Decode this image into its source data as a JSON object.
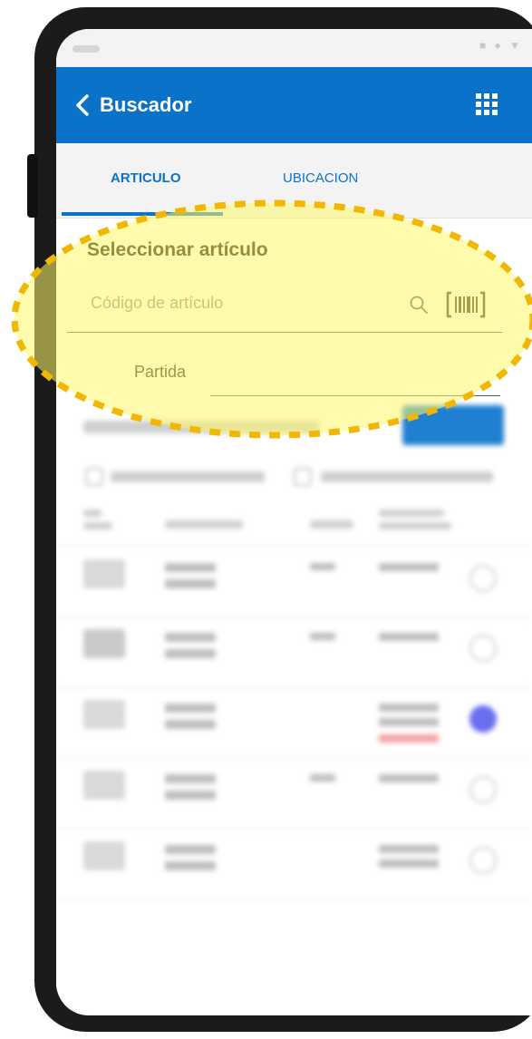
{
  "appbar": {
    "title": "Buscador"
  },
  "tabs": [
    {
      "label": "ARTICULO",
      "active": true
    },
    {
      "label": "UBICACION",
      "active": false
    }
  ],
  "form": {
    "section_title": "Seleccionar artículo",
    "article_placeholder": "Código de artículo",
    "partida_label": "Partida"
  },
  "icons": {
    "back": "chevron-left-icon",
    "menu": "grid-icon",
    "search": "search-icon",
    "barcode": "barcode-icon"
  },
  "colors": {
    "primary": "#0b72c9",
    "highlight_fill": "#fff76a",
    "highlight_border": "#f2b705"
  }
}
